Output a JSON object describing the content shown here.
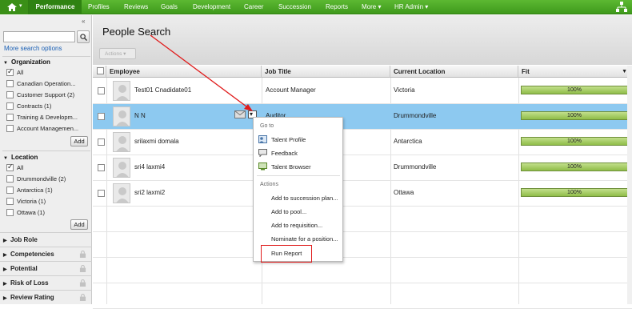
{
  "nav": {
    "active": "Performance",
    "items": [
      "Profiles",
      "Reviews",
      "Goals",
      "Development",
      "Career",
      "Succession",
      "Reports",
      "More ▾",
      "HR Admin ▾"
    ]
  },
  "sidebar": {
    "collapse_glyph": "«",
    "search_placeholder": "",
    "more_search": "More search options",
    "organization": {
      "label": "Organization",
      "options": [
        "All",
        "Canadian Operation...",
        "Customer Support (2)",
        "Contracts (1)",
        "Training & Developm...",
        "Account Managemen..."
      ],
      "add": "Add"
    },
    "location": {
      "label": "Location",
      "options": [
        "All",
        "Drummondville (2)",
        "Antarctica (1)",
        "Victoria (1)",
        "Ottawa (1)"
      ],
      "add": "Add"
    },
    "collapsed": [
      "Job Role",
      "Competencies",
      "Potential",
      "Risk of Loss",
      "Review Rating"
    ]
  },
  "main": {
    "title": "People Search",
    "actions": "Actions ▾",
    "columns": [
      "Employee",
      "Job Title",
      "Current Location",
      "Fit"
    ],
    "rows": [
      {
        "name": "Test01 Cnadidate01",
        "title": "Account Manager",
        "location": "Victoria",
        "fit": "100%"
      },
      {
        "name": "N N",
        "title": "Auditor",
        "location": "Drummondville",
        "fit": "100%"
      },
      {
        "name": "srilaxmi domala",
        "title": "",
        "location": "Antarctica",
        "fit": "100%"
      },
      {
        "name": "sri4 laxmi4",
        "title": "",
        "location": "Drummondville",
        "fit": "100%"
      },
      {
        "name": "sri2 laxmi2",
        "title": "",
        "location": "Ottawa",
        "fit": "100%"
      }
    ]
  },
  "menu": {
    "goto_label": "Go to",
    "goto_items": [
      "Talent Profile",
      "Feedback",
      "Talent Browser"
    ],
    "actions_label": "Actions",
    "action_items": [
      "Add to succession plan...",
      "Add to pool...",
      "Add to requisition...",
      "Nominate for a position...",
      "Run Report"
    ]
  },
  "colors": {
    "nav_green": "#4aa825",
    "selected_row": "#8dc9f0",
    "fit_bar": "#a6cf62",
    "annotation_red": "#e01b1b"
  }
}
